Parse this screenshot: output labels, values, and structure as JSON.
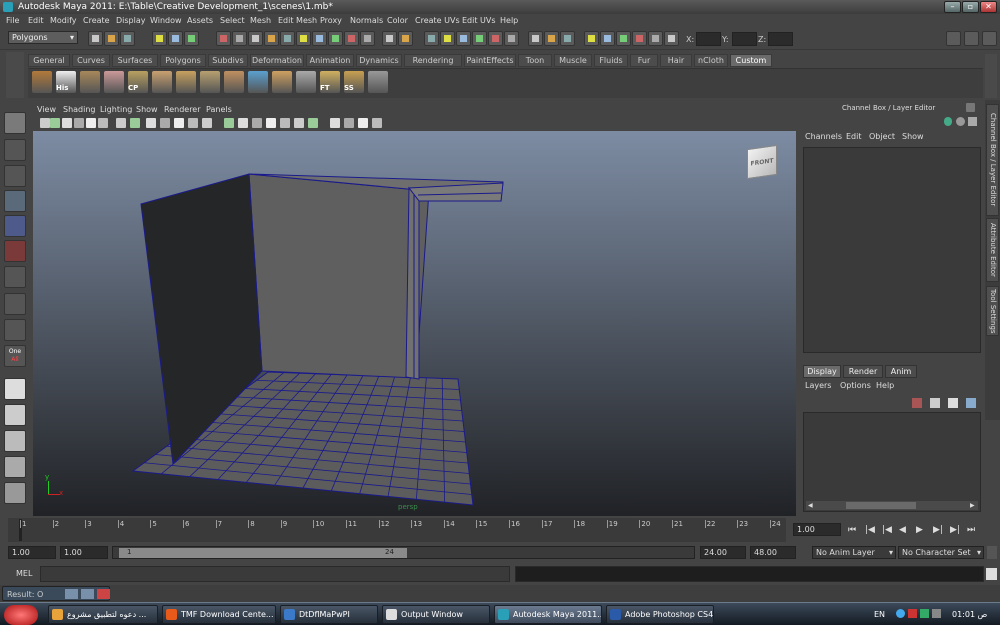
{
  "window": {
    "title": "Autodesk Maya 2011: E:\\Table\\Creative Development_1\\scenes\\1.mb*"
  },
  "menubar": [
    "File",
    "Edit",
    "Modify",
    "Create",
    "Display",
    "Window",
    "Assets",
    "Select",
    "Mesh",
    "Edit Mesh",
    "Proxy",
    "Normals",
    "Color",
    "Create UVs",
    "Edit UVs",
    "Help"
  ],
  "statusline": {
    "mode": "Polygons",
    "x_label": "X:",
    "y_label": "Y:",
    "z_label": "Z:"
  },
  "shelf": {
    "tabs": [
      "General",
      "Curves",
      "Surfaces",
      "Polygons",
      "Subdivs",
      "Deformation",
      "Animation",
      "Dynamics",
      "Rendering",
      "PaintEffects",
      "Toon",
      "Muscle",
      "Fluids",
      "Fur",
      "Hair",
      "nCloth",
      "Custom"
    ],
    "active": "Custom",
    "icon_labels": [
      "His",
      "CP",
      "FT",
      "SS"
    ]
  },
  "viewport": {
    "menu": [
      "View",
      "Shading",
      "Lighting",
      "Show",
      "Renderer",
      "Panels"
    ],
    "camera_label": "persp",
    "viewcube_label": "FRONT",
    "axis_x": "x",
    "axis_y": "y"
  },
  "tool_box": {
    "one_label": "One",
    "all_label": "All"
  },
  "channel_box": {
    "title": "Channel Box / Layer Editor",
    "menu": [
      "Channels",
      "Edit",
      "Object",
      "Show"
    ]
  },
  "layer_editor": {
    "tabs": [
      "Display",
      "Render",
      "Anim"
    ],
    "active": "Display",
    "menu": [
      "Layers",
      "Options",
      "Help"
    ]
  },
  "side_tabs": [
    "Channel Box / Layer Editor",
    "Attribute Editor",
    "Tool Settings"
  ],
  "timeline": {
    "ticks": [
      "1",
      "2",
      "3",
      "4",
      "5",
      "6",
      "7",
      "8",
      "9",
      "10",
      "11",
      "12",
      "13",
      "14",
      "15",
      "16",
      "17",
      "18",
      "19",
      "20",
      "21",
      "22",
      "23",
      "24"
    ],
    "current_frame": "1.00"
  },
  "range": {
    "start": "1.00",
    "start2": "1.00",
    "slider_start": "1",
    "slider_end": "24",
    "end": "24.00",
    "end2": "48.00",
    "anim_layer": "No Anim Layer",
    "character_set": "No Character Set"
  },
  "command_line": {
    "label": "MEL"
  },
  "help_line": {
    "text": "Result: O"
  },
  "taskbar": {
    "items": [
      "دعوه لتطبيق مشروع ...",
      "TMF Download Cente...",
      "DtDflMaPwPI",
      "Output Window",
      "Autodesk Maya 2011...",
      "Adobe Photoshop CS4"
    ],
    "active_index": 4,
    "lang": "EN",
    "clock": "01:01 ص"
  },
  "colors": {
    "wireframe": "#1a1a8c",
    "wall": "#5f5f5f",
    "floor": "#5c5c5c",
    "viewport_top": "#7d8ca3"
  }
}
